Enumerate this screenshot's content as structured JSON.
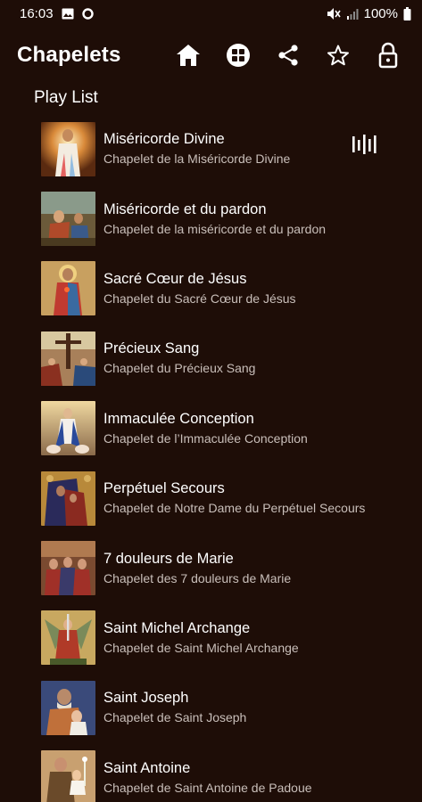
{
  "status_bar": {
    "time": "16:03",
    "battery": "100%",
    "icons": [
      "gallery-icon",
      "circle-notification-icon",
      "mute-icon",
      "signal-icon",
      "battery-icon"
    ]
  },
  "app_bar": {
    "title": "Chapelets",
    "actions": [
      "home-icon",
      "grid-apps-icon",
      "share-icon",
      "star-icon",
      "lock-icon"
    ]
  },
  "section": {
    "title": "Play List"
  },
  "playlist": [
    {
      "title": "Miséricorde Divine",
      "subtitle": "Chapelet de la Miséricorde Divine",
      "playing": true
    },
    {
      "title": "Miséricorde et du pardon",
      "subtitle": "Chapelet de la miséricorde et du pardon"
    },
    {
      "title": "Sacré Cœur de Jésus",
      "subtitle": "Chapelet du Sacré Cœur de Jésus"
    },
    {
      "title": "Précieux Sang",
      "subtitle": "Chapelet du Précieux Sang"
    },
    {
      "title": "Immaculée Conception",
      "subtitle": "Chapelet de l’Immaculée Conception"
    },
    {
      "title": "Perpétuel Secours",
      "subtitle": "Chapelet de Notre Dame du Perpétuel Secours"
    },
    {
      "title": "7 douleurs de Marie",
      "subtitle": "Chapelet des 7 douleurs de Marie"
    },
    {
      "title": "Saint Michel Archange",
      "subtitle": "Chapelet de Saint Michel Archange"
    },
    {
      "title": "Saint Joseph",
      "subtitle": "Chapelet de Saint Joseph"
    },
    {
      "title": "Saint Antoine",
      "subtitle": "Chapelet de Saint Antoine de Padoue"
    }
  ],
  "colors": {
    "background": "#1e0d07",
    "text": "#ffffff",
    "subtext": "#c9bfba"
  }
}
